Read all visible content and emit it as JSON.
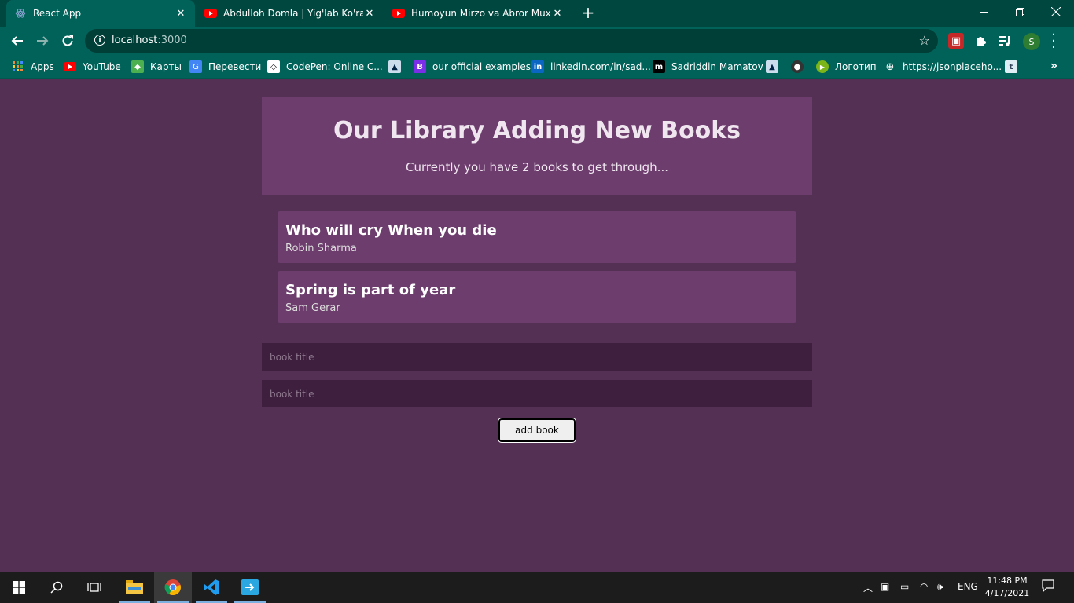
{
  "browser": {
    "tabs": [
      {
        "title": "React App",
        "icon": "react-icon",
        "active": true
      },
      {
        "title": "Abdulloh Domla | Yig'lab Ko'rasiz",
        "icon": "youtube-icon",
        "active": false
      },
      {
        "title": "Humoyun Mirzo va Abror Muxtor",
        "icon": "youtube-icon",
        "active": false
      }
    ],
    "new_tab": "+",
    "url_host": "localhost",
    "url_port": ":3000",
    "profile_initial": "S",
    "bookmarks": [
      {
        "label": "Apps",
        "icon": "apps-grid-icon"
      },
      {
        "label": "YouTube",
        "icon": "youtube-icon"
      },
      {
        "label": "Карты",
        "icon": "maps-icon"
      },
      {
        "label": "Перевести",
        "icon": "translate-icon"
      },
      {
        "label": "CodePen: Online C...",
        "icon": "codepen-icon"
      },
      {
        "label": "",
        "icon": "graduation-cap-icon"
      },
      {
        "label": "our official examples",
        "icon": "bootstrap-icon"
      },
      {
        "label": "linkedin.com/in/sad...",
        "icon": "linkedin-icon"
      },
      {
        "label": "Sadriddin Mamatov",
        "icon": "medium-icon"
      },
      {
        "label": "",
        "icon": "graduation-cap-icon"
      },
      {
        "label": "",
        "icon": "github-icon"
      },
      {
        "label": "Логотип",
        "icon": "play-circle-icon"
      },
      {
        "label": "https://jsonplaceho...",
        "icon": "globe-icon"
      },
      {
        "label": "",
        "icon": "tumblr-icon"
      }
    ],
    "bookmarks_more": "»"
  },
  "app": {
    "heading": "Our Library Adding New Books",
    "subheading": "Currently you have 2 books to get through...",
    "books": [
      {
        "title": "Who will cry When you die",
        "author": "Robin Sharma"
      },
      {
        "title": "Spring is part of year",
        "author": "Sam Gerar"
      }
    ],
    "title_placeholder": "book title",
    "author_placeholder": "book title",
    "add_button": "add book"
  },
  "taskbar": {
    "language": "ENG",
    "time": "11:48 PM",
    "date": "4/17/2021"
  },
  "colors": {
    "page_bg": "#553055",
    "card_bg": "#6d3d6d",
    "input_bg": "#3e1f3e",
    "chrome_dark": "#00473f",
    "chrome_light": "#01625a"
  }
}
